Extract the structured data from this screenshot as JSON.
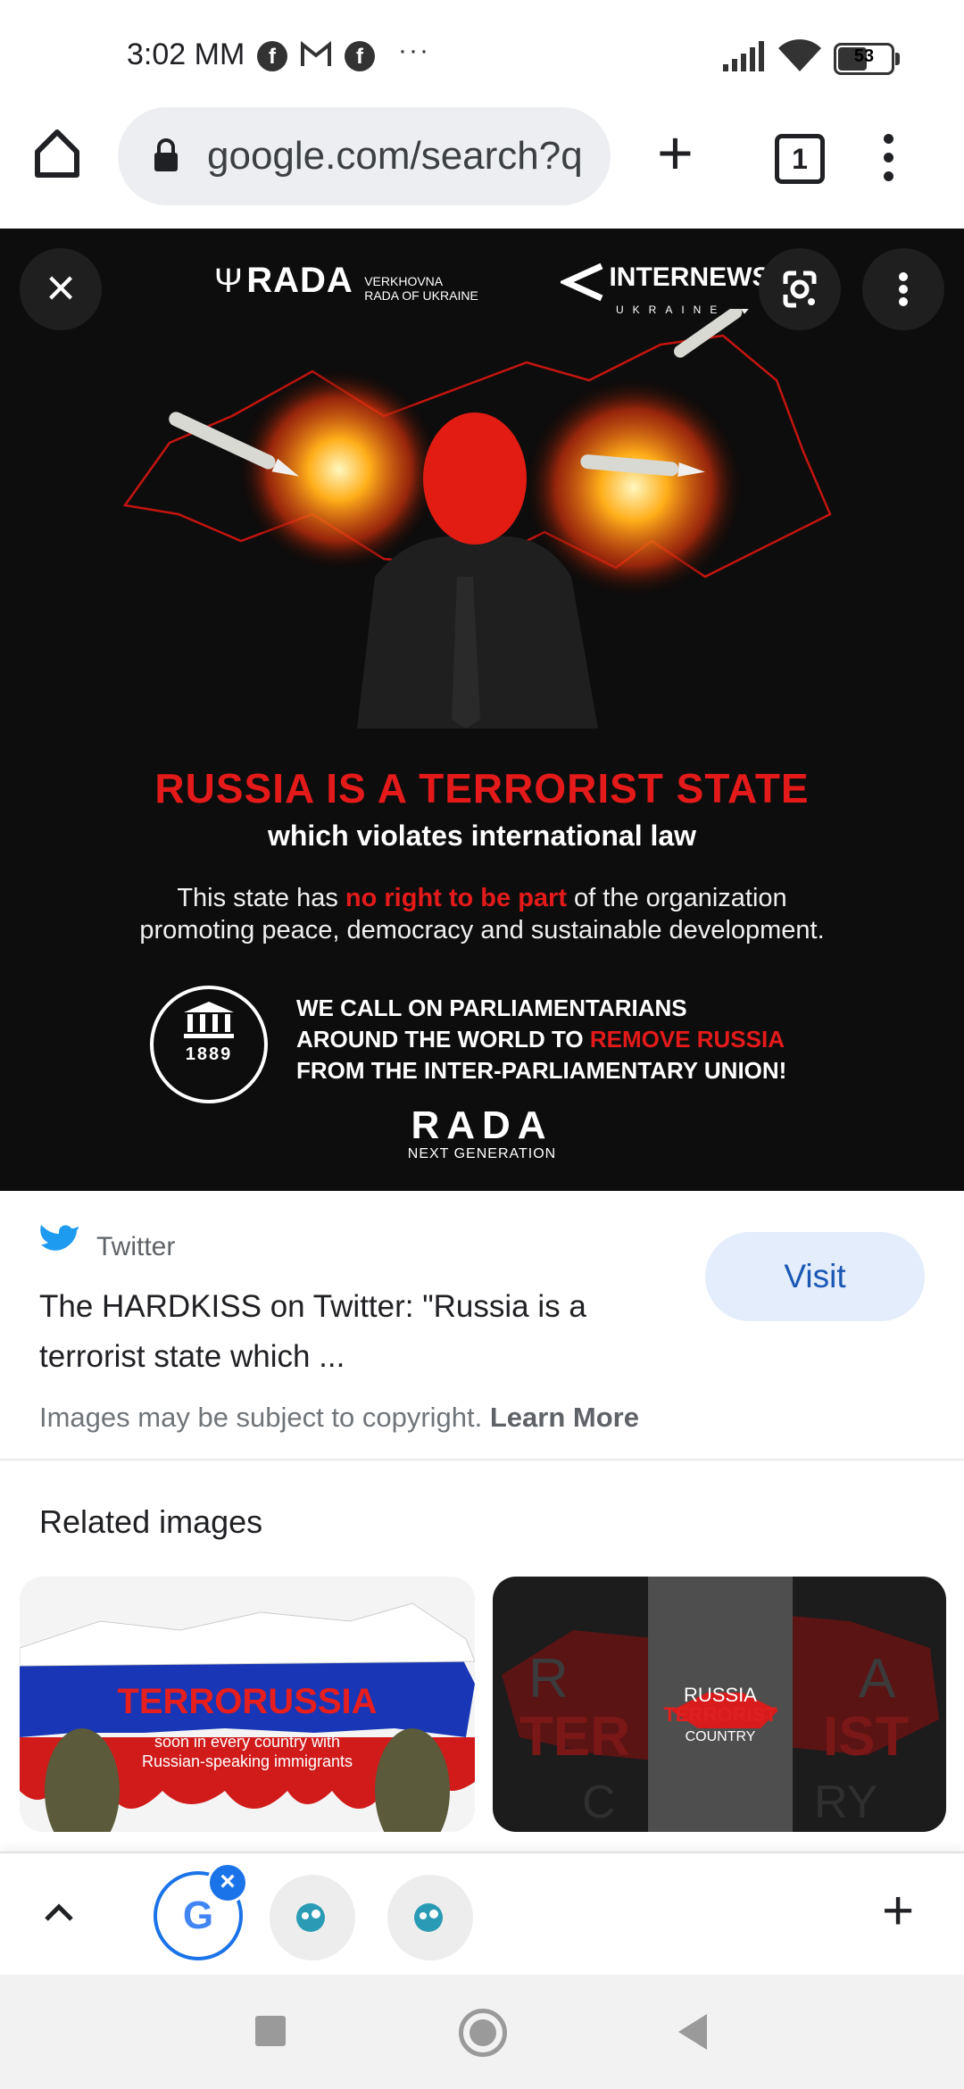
{
  "status_bar": {
    "time": "3:02 MM",
    "notification_icons": [
      "facebook-icon",
      "gmail-icon",
      "facebook-icon"
    ],
    "more": "···",
    "battery": "53"
  },
  "toolbar": {
    "url": "google.com/search?q",
    "tab_count": "1"
  },
  "viewer": {
    "rada_logo": "RADA",
    "rada_subtitle_1": "VERKHOVNA",
    "rada_subtitle_2": "RADA OF UKRAINE",
    "internews_logo": "INTERNEWS",
    "internews_subtitle": "UKRAINE",
    "headline": "RUSSIA IS A TERRORIST STATE",
    "subheadline": "which violates international law",
    "body_part1": "This state has ",
    "body_highlight": "no right to be part",
    "body_part2": " of the organization",
    "body_line2": "promoting peace, democracy and sustainable development.",
    "ipu_year": "1889",
    "call_line1": "WE CALL ON PARLIAMENTARIANS",
    "call_line2_part1": "AROUND THE WORLD TO ",
    "call_line2_highlight": "REMOVE RUSSIA",
    "call_line3": "FROM THE INTER-PARLIAMENTARY UNION!",
    "footer_logo": "RADA",
    "footer_sub": "NEXT GENERATION"
  },
  "result": {
    "source": "Twitter",
    "title": "The HARDKISS on Twitter: \"Russia is a terrorist state which ...",
    "visit_label": "Visit",
    "copyright_text": "Images may be subject to copyright.",
    "learn_more": "Learn More"
  },
  "related": {
    "heading": "Related images",
    "items": [
      {
        "big_text": "TERRORUSSIA",
        "caption_1": "soon in every country with",
        "caption_2": "Russian-speaking immigrants"
      },
      {
        "overlay_1": "RUSSIA",
        "overlay_2": "TERRORIST",
        "overlay_3": "COUNTRY"
      }
    ]
  },
  "colors": {
    "accent_red": "#e41a1a",
    "visit_bg": "#e3edfb",
    "visit_text": "#1a57b4",
    "tab_blue": "#1a73e8"
  }
}
